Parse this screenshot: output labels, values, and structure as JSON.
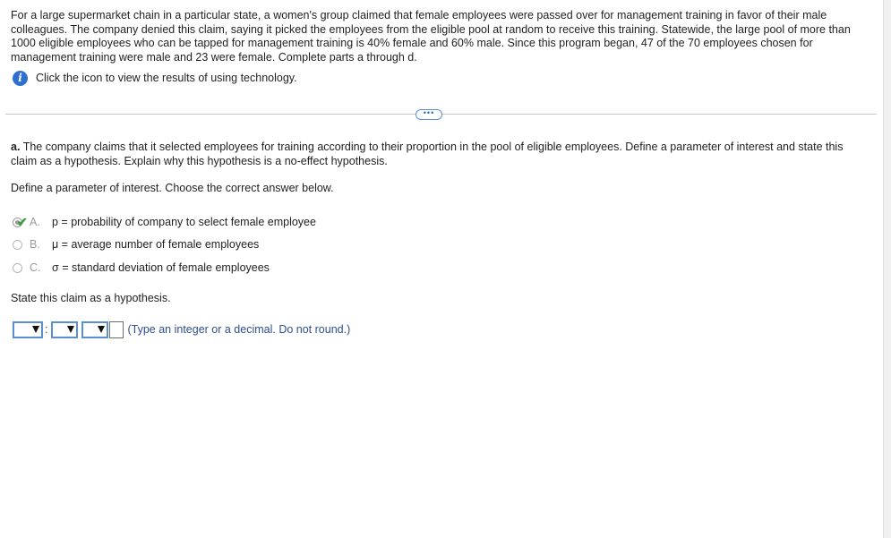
{
  "problem": {
    "intro": "For a large supermarket chain in a particular state, a women's group claimed that female employees were passed over for management training in favor of their male colleagues. The company denied this claim, saying it picked the employees from the eligible pool at random to receive this training. Statewide, the large pool of more than 1000 eligible employees who can be tapped for management training is 40% female and 60% male. Since this program began, 47 of the 70 employees chosen for management training were male and 23 were female. Complete parts a through d.",
    "tech_link": "Click the icon to view the results of using technology."
  },
  "expand_label": "•••",
  "part_a": {
    "label": "a.",
    "question": "The company claims that it selected employees for training according to their proportion in the pool of eligible employees. Define a parameter of interest and state this claim as a hypothesis. Explain why this hypothesis is a no-effect hypothesis.",
    "define_prompt": "Define a parameter of interest. Choose the correct answer below.",
    "options": [
      {
        "letter": "A.",
        "text": "p = probability of company to select female employee",
        "selected": true
      },
      {
        "letter": "B.",
        "text": "μ = average number of female employees",
        "selected": false
      },
      {
        "letter": "C.",
        "text": "σ = standard deviation of female employees",
        "selected": false
      }
    ],
    "state_prompt": "State this claim as a hypothesis.",
    "colon": ":",
    "hint": "(Type an integer or a decimal. Do not round.)"
  },
  "colors": {
    "accent": "#2f6fcf",
    "correct": "#3d9a3d",
    "hint": "#2b4f8f"
  }
}
